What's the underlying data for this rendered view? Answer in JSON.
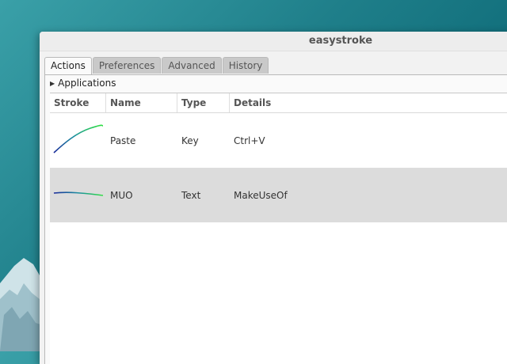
{
  "window": {
    "title": "easystroke"
  },
  "tabs": [
    {
      "label": "Actions",
      "active": true
    },
    {
      "label": "Preferences",
      "active": false
    },
    {
      "label": "Advanced",
      "active": false
    },
    {
      "label": "History",
      "active": false
    }
  ],
  "actions": {
    "expander_label": "Applications",
    "columns": {
      "stroke": "Stroke",
      "name": "Name",
      "type": "Type",
      "details": "Details"
    },
    "rows": [
      {
        "name": "Paste",
        "type": "Key",
        "details": "Ctrl+V",
        "selected": false
      },
      {
        "name": "MUO",
        "type": "Text",
        "details": "MakeUseOf",
        "selected": true
      }
    ]
  }
}
